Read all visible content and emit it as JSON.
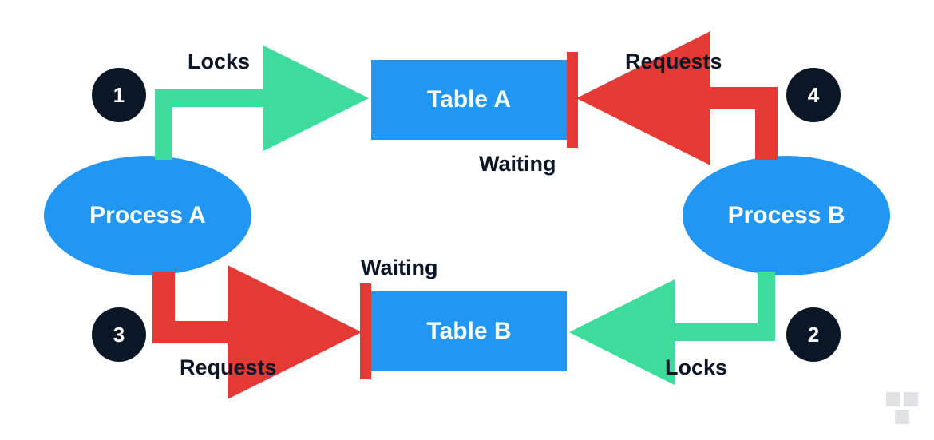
{
  "processes": {
    "a": "Process A",
    "b": "Process B"
  },
  "tables": {
    "a": "Table A",
    "b": "Table B"
  },
  "steps": {
    "s1": "1",
    "s2": "2",
    "s3": "3",
    "s4": "4"
  },
  "labels": {
    "locks_a": "Locks",
    "requests_a": "Requests",
    "locks_b": "Locks",
    "requests_b": "Requests",
    "waiting_a": "Waiting",
    "waiting_b": "Waiting"
  },
  "colors": {
    "blue": "#2196F3",
    "green": "#3EDC9C",
    "red": "#E53935",
    "dark": "#0B1726"
  }
}
